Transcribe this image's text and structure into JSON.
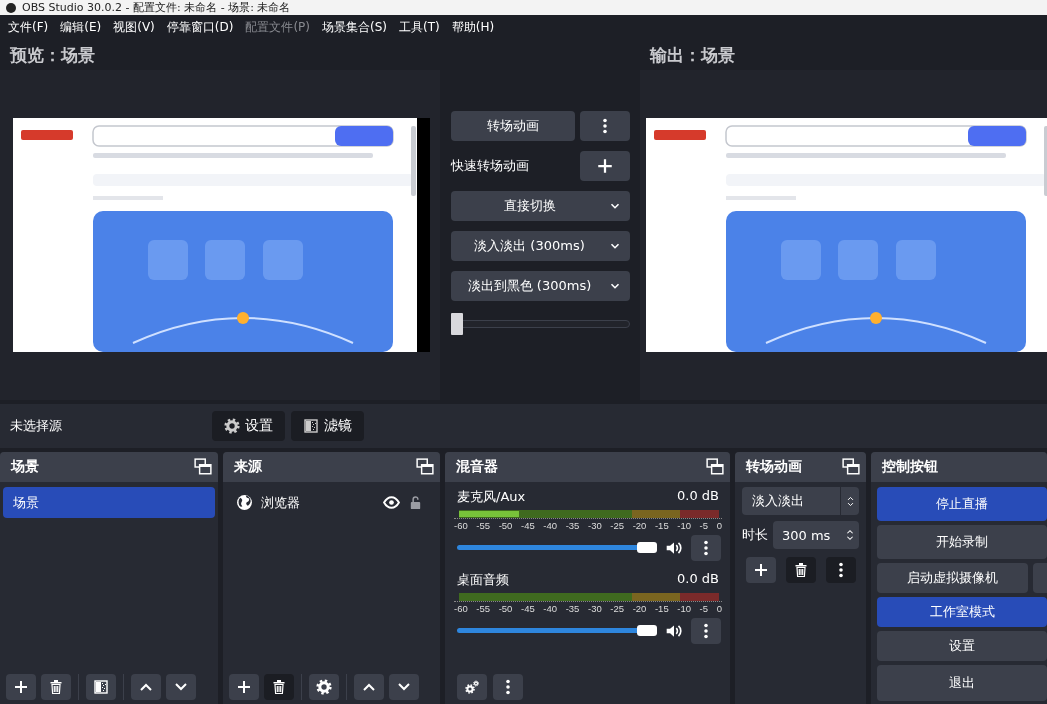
{
  "window": {
    "title": "OBS Studio 30.0.2 - 配置文件: 未命名 - 场景: 未命名"
  },
  "menu": [
    {
      "label": "文件(F)",
      "disabled": false
    },
    {
      "label": "编辑(E)",
      "disabled": false
    },
    {
      "label": "视图(V)",
      "disabled": false
    },
    {
      "label": "停靠窗口(D)",
      "disabled": false
    },
    {
      "label": "配置文件(P)",
      "disabled": true
    },
    {
      "label": "场景集合(S)",
      "disabled": false
    },
    {
      "label": "工具(T)",
      "disabled": false
    },
    {
      "label": "帮助(H)",
      "disabled": false
    }
  ],
  "preview": {
    "title": "预览：场景"
  },
  "program": {
    "title": "输出：场景"
  },
  "transition_controls": {
    "transition_button": "转场动画",
    "quick_transitions_label": "快速转场动画",
    "quick_transitions": [
      "直接切换",
      "淡入淡出 (300ms)",
      "淡出到黑色 (300ms)"
    ],
    "t_bar": {
      "level": 0
    }
  },
  "source_toolbar": {
    "label": "未选择源",
    "buttons": [
      {
        "kind": "properties",
        "label": "设置"
      },
      {
        "kind": "filters",
        "label": "滤镜"
      }
    ]
  },
  "scenes": {
    "title": "场景",
    "items": [
      {
        "label": "场景",
        "selected": true
      }
    ]
  },
  "sources": {
    "title": "来源",
    "items": [
      {
        "label": "浏览器",
        "visible": true,
        "locked": false
      }
    ]
  },
  "mixer": {
    "title": "混音器",
    "channels": [
      {
        "name": "麦克风/Aux",
        "reading": "0.0 dB",
        "meter": {
          "level": 0.23
        },
        "scale": [
          "-60",
          "-55",
          "-50",
          "-45",
          "-40",
          "-35",
          "-30",
          "-25",
          "-20",
          "-15",
          "-10",
          "-5",
          "0"
        ],
        "volume": {
          "level": 1
        },
        "muted": false
      },
      {
        "name": "桌面音频",
        "reading": "0.0 dB",
        "meter": {
          "level": 0
        },
        "scale": [
          "-60",
          "-55",
          "-50",
          "-45",
          "-40",
          "-35",
          "-30",
          "-25",
          "-20",
          "-15",
          "-10",
          "-5",
          "0"
        ],
        "volume": {
          "level": 1
        },
        "muted": false
      }
    ]
  },
  "transitions": {
    "title": "转场动画",
    "transition": "淡入淡出",
    "duration_label": "时长",
    "duration": "300 ms"
  },
  "controls": {
    "title": "控制按钮",
    "buttons": [
      {
        "label": "停止直播",
        "active": true
      },
      {
        "label": "开始录制",
        "active": false
      },
      {
        "label": "启动虚拟摄像机",
        "active": false
      },
      {
        "label": "工作室模式",
        "active": true
      },
      {
        "label": "设置",
        "active": false
      },
      {
        "label": "退出",
        "active": false
      }
    ]
  }
}
